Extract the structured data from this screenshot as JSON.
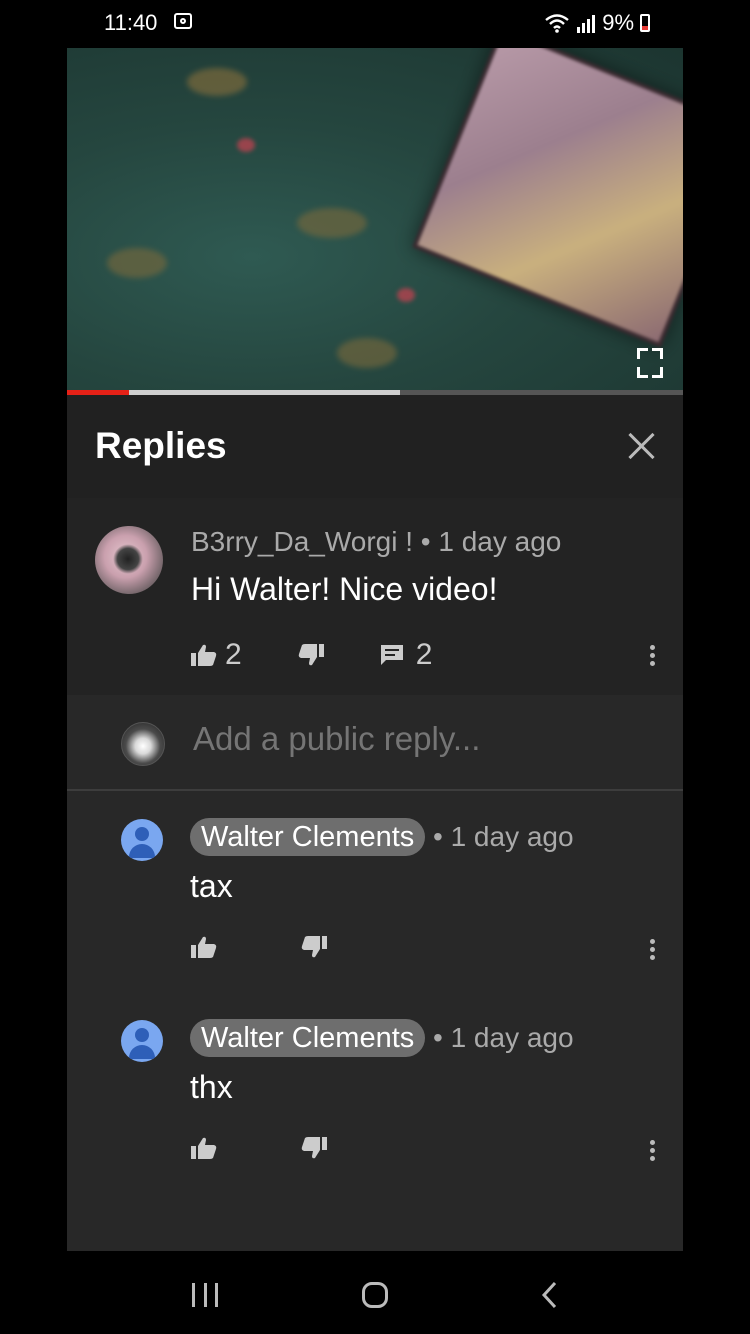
{
  "status_bar": {
    "time": "11:40",
    "battery": "9%",
    "icons": [
      "screenshot-icon",
      "wifi-icon",
      "signal-icon",
      "battery-low-icon"
    ]
  },
  "video": {
    "progress_played": 0.1,
    "progress_buffered": 0.54,
    "fullscreen_icon": "fullscreen-icon"
  },
  "panel": {
    "title": "Replies",
    "close_icon": "close-icon"
  },
  "parent_comment": {
    "author": "B3rry_Da_Worgi !",
    "meta": "B3rry_Da_Worgi ! • 1 day ago",
    "text": "Hi Walter! Nice video!",
    "likes": "2",
    "replies": "2"
  },
  "reply_box": {
    "placeholder": "Add a public reply..."
  },
  "replies": [
    {
      "author": "Walter Clements",
      "time": "• 1 day ago",
      "text": "tax"
    },
    {
      "author": "Walter Clements",
      "time": "• 1 day ago",
      "text": "thx"
    }
  ],
  "colors": {
    "accent": "#e62117",
    "panel_bg": "#282828",
    "header_bg": "#212121",
    "author_chip": "#6e6e6e",
    "user_avatar": "#7aa7f0"
  }
}
